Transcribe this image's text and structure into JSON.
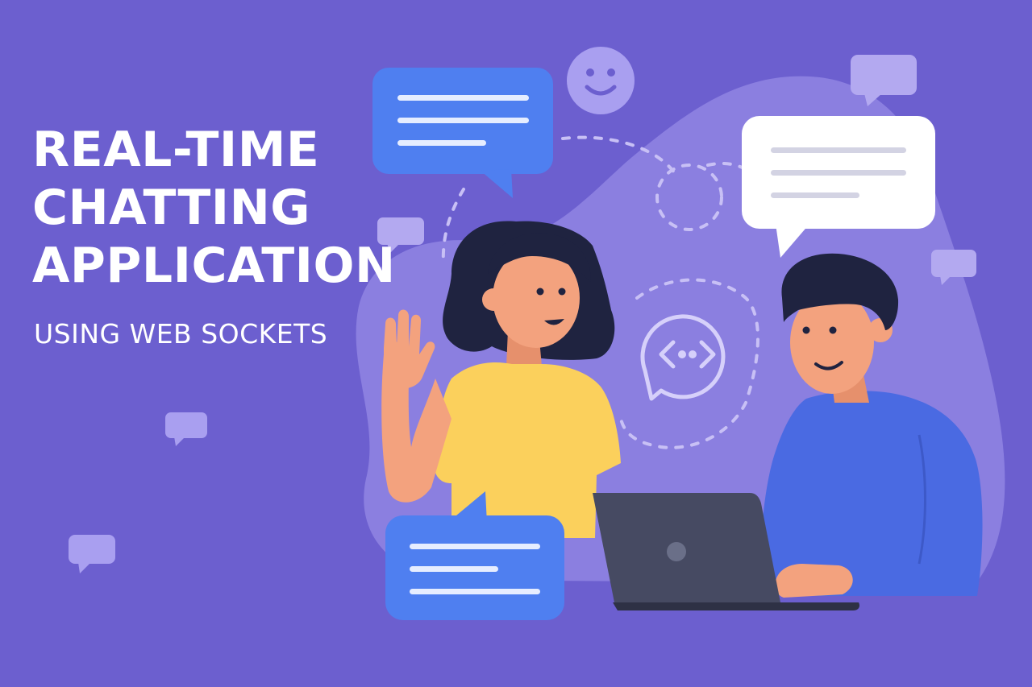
{
  "title": {
    "line1": "REAL-TIME",
    "line2": "CHATTING",
    "line3": "APPLICATION"
  },
  "subtitle": "USING WEB SOCKETS",
  "icons": {
    "smiley": "smiley-face-icon",
    "code": "code-brackets-icon",
    "chat": "chat-bubble-icon"
  },
  "colors": {
    "background": "#6c5fcf",
    "blob": "#8b7fe0",
    "bubble_blue": "#4f7ff0",
    "bubble_white": "#ffffff",
    "bubble_small": "#b3a9f0",
    "woman_shirt": "#fbd05c",
    "man_shirt": "#4a6ae2",
    "skin": "#f3a27e",
    "hair": "#1f2340",
    "laptop": "#464a62",
    "text": "#ffffff"
  }
}
